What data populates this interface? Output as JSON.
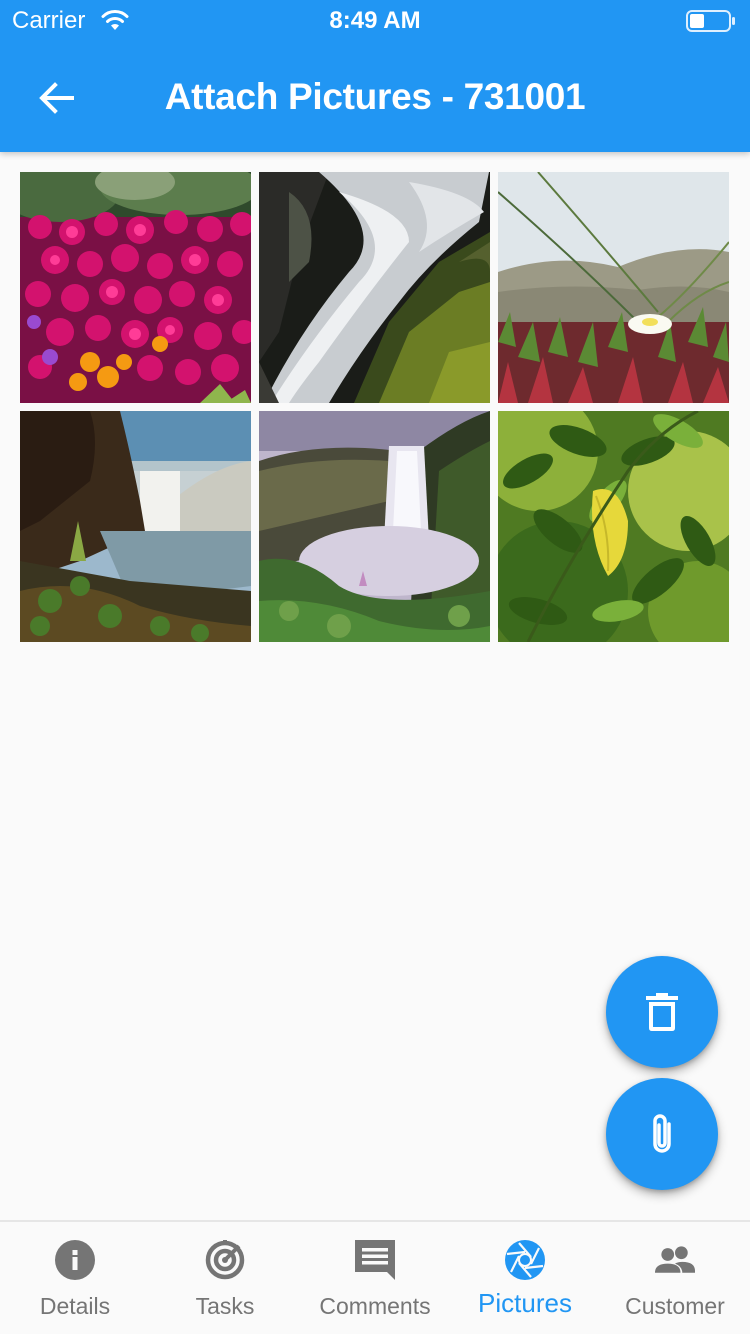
{
  "status_bar": {
    "carrier": "Carrier",
    "time": "8:49 AM"
  },
  "app_bar": {
    "title": "Attach Pictures - 731001",
    "back_icon": "arrow-back-icon",
    "color": "#2196f3"
  },
  "photos": [
    {
      "subject": "pink flowers"
    },
    {
      "subject": "waterfall over mossy rocks"
    },
    {
      "subject": "white flower in succulent field"
    },
    {
      "subject": "waterfall from cliff"
    },
    {
      "subject": "waterfall in green valley"
    },
    {
      "subject": "green leaves with yellow leaf"
    }
  ],
  "fabs": {
    "delete": {
      "icon": "trash-icon"
    },
    "attach": {
      "icon": "paperclip-icon"
    }
  },
  "bottom_nav": {
    "active_color": "#2196f3",
    "inactive_color": "#757575",
    "items": [
      {
        "label": "Details",
        "icon": "info-icon"
      },
      {
        "label": "Tasks",
        "icon": "radar-icon"
      },
      {
        "label": "Comments",
        "icon": "comment-icon"
      },
      {
        "label": "Pictures",
        "icon": "camera-shutter-icon",
        "active": true
      },
      {
        "label": "Customer",
        "icon": "people-icon"
      }
    ]
  }
}
